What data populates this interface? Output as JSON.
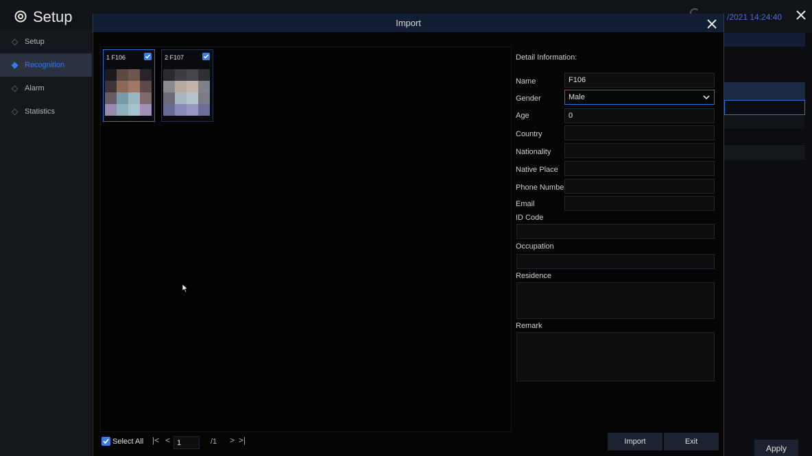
{
  "app": {
    "title": "Setup",
    "clock": "/2021 14:24:40"
  },
  "sidebar": {
    "items": [
      {
        "label": "Setup"
      },
      {
        "label": "Recognition"
      },
      {
        "label": "Alarm"
      },
      {
        "label": "Statistics"
      }
    ]
  },
  "background": {
    "apply_label": "Apply"
  },
  "dialog": {
    "title": "Import",
    "thumbnails": [
      {
        "label": "1 F106",
        "checked": true
      },
      {
        "label": "2 F107",
        "checked": true
      }
    ],
    "details": {
      "heading": "Detail Information:",
      "fields": {
        "name_label": "Name",
        "name_value": "F106",
        "gender_label": "Gender",
        "gender_value": "Male",
        "age_label": "Age",
        "age_value": "0",
        "country_label": "Country",
        "country_value": "",
        "nationality_label": "Nationality",
        "nationality_value": "",
        "native_place_label": "Native Place",
        "native_place_value": "",
        "phone_label": "Phone Number",
        "phone_value": "",
        "email_label": "Email",
        "email_value": "",
        "id_code_label": "ID Code",
        "id_code_value": "",
        "occupation_label": "Occupation",
        "occupation_value": "",
        "residence_label": "Residence",
        "residence_value": "",
        "remark_label": "Remark",
        "remark_value": ""
      }
    },
    "bottom": {
      "select_all_label": "Select All",
      "select_all_checked": true,
      "page_value": "1",
      "page_total": "/1",
      "import_label": "Import",
      "exit_label": "Exit"
    }
  },
  "colors": {
    "accent": "#3b7be6",
    "border_blue": "#2f6fd8",
    "header_bg": "#131d33"
  },
  "icons": [
    "gear-icon",
    "close-icon",
    "checkbox-checked-icon",
    "chevron-down-icon",
    "first-page-icon",
    "prev-page-icon",
    "next-page-icon",
    "last-page-icon",
    "cursor-icon"
  ]
}
